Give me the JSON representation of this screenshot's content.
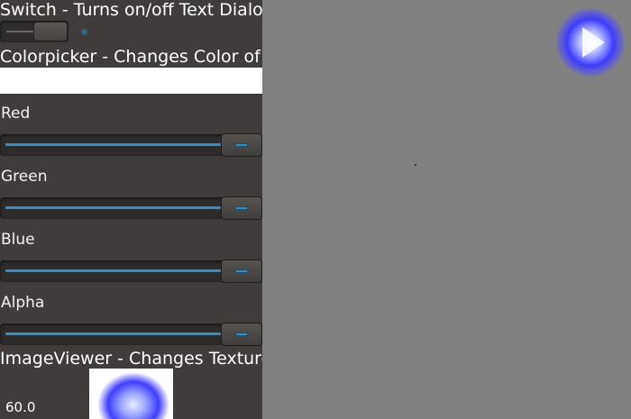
{
  "switch_section": {
    "title": "Switch - Turns on/off Text Dialog",
    "state": "on"
  },
  "colorpicker_section": {
    "title": "Colorpicker - Changes Color of Rect",
    "rect_color": "#ffffff"
  },
  "sliders": [
    {
      "label": "Red",
      "value_fraction": 1.0
    },
    {
      "label": "Green",
      "value_fraction": 1.0
    },
    {
      "label": "Blue",
      "value_fraction": 1.0
    },
    {
      "label": "Alpha",
      "value_fraction": 1.0
    }
  ],
  "imageviewer_section": {
    "title": "ImageViewer - Changes Texture of Image"
  },
  "fps_readout": "60.0",
  "colors": {
    "accent": "#2f8fca",
    "panel_background": "#3f3c3b",
    "stage_background": "#808080",
    "sprite_glow": "#3b3bff"
  },
  "icons": {
    "sprite": "blue-glow-play-sprite-icon",
    "image_texture": "blue-glow-texture-icon"
  }
}
